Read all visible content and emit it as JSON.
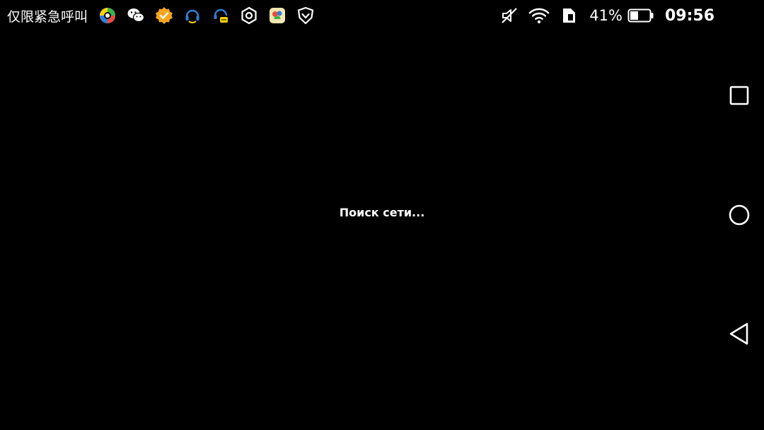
{
  "status_bar": {
    "carrier_text": "仅限紧急呼叫",
    "notification_icons": [
      "360-security-icon",
      "wechat-icon",
      "badge-check-icon",
      "headset-icon",
      "headset-chat-icon",
      "hexagon-settings-icon",
      "game-app-icon",
      "shield-icon"
    ],
    "system_icons": [
      "mute-icon",
      "wifi-icon",
      "sim-card-icon"
    ],
    "battery_percent": "41%",
    "battery_level": 0.41,
    "time": "09:56"
  },
  "main": {
    "message": "Поиск сети..."
  },
  "nav_bar": {
    "buttons": [
      "recent-apps",
      "home",
      "back"
    ]
  },
  "colors": {
    "background": "#000000",
    "text": "#ffffff",
    "green": "#3ab34a",
    "orange": "#f7a51c",
    "yellow": "#f5d10a",
    "blue": "#2f7fd4"
  }
}
